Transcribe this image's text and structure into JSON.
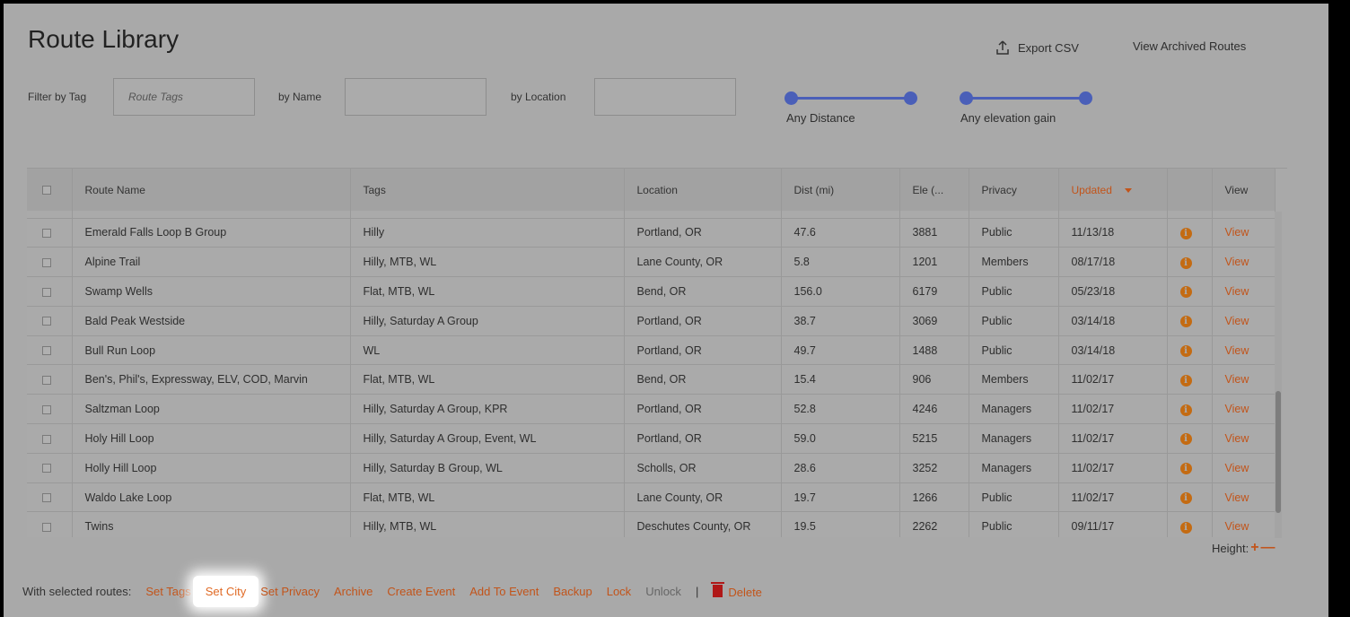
{
  "title": "Route Library",
  "actions": {
    "export": "Export CSV",
    "archived": "View Archived Routes"
  },
  "filters": {
    "tag_label": "Filter by Tag",
    "tag_placeholder": "Route Tags",
    "name_label": "by Name",
    "location_label": "by Location",
    "distance_label": "Any Distance",
    "elevation_label": "Any elevation gain"
  },
  "columns": [
    "Route Name",
    "Tags",
    "Location",
    "Dist (mi)",
    "Ele (...",
    "Privacy",
    "Updated",
    "",
    "View"
  ],
  "rows": [
    {
      "name": "Emerald Falls Loop B Group",
      "tags": "Hilly",
      "location": "Portland, OR",
      "dist": "47.6",
      "ele": "3881",
      "privacy": "Public",
      "updated": "11/13/18",
      "view": "View"
    },
    {
      "name": "Alpine Trail",
      "tags": "Hilly, MTB, WL",
      "location": "Lane County, OR",
      "dist": "5.8",
      "ele": "1201",
      "privacy": "Members",
      "updated": "08/17/18",
      "view": "View"
    },
    {
      "name": "Swamp Wells",
      "tags": "Flat, MTB, WL",
      "location": "Bend, OR",
      "dist": "156.0",
      "ele": "6179",
      "privacy": "Public",
      "updated": "05/23/18",
      "view": "View"
    },
    {
      "name": "Bald Peak Westside",
      "tags": "Hilly, Saturday A Group",
      "location": "Portland, OR",
      "dist": "38.7",
      "ele": "3069",
      "privacy": "Public",
      "updated": "03/14/18",
      "view": "View"
    },
    {
      "name": "Bull Run Loop",
      "tags": "WL",
      "location": "Portland, OR",
      "dist": "49.7",
      "ele": "1488",
      "privacy": "Public",
      "updated": "03/14/18",
      "view": "View"
    },
    {
      "name": "Ben's, Phil's, Expressway, ELV, COD, Marvin",
      "tags": "Flat, MTB, WL",
      "location": "Bend, OR",
      "dist": "15.4",
      "ele": "906",
      "privacy": "Members",
      "updated": "11/02/17",
      "view": "View"
    },
    {
      "name": "Saltzman Loop",
      "tags": "Hilly, Saturday A Group, KPR",
      "location": "Portland, OR",
      "dist": "52.8",
      "ele": "4246",
      "privacy": "Managers",
      "updated": "11/02/17",
      "view": "View"
    },
    {
      "name": "Holy Hill Loop",
      "tags": "Hilly, Saturday A Group, Event, WL",
      "location": "Portland, OR",
      "dist": "59.0",
      "ele": "5215",
      "privacy": "Managers",
      "updated": "11/02/17",
      "view": "View"
    },
    {
      "name": "Holly Hill Loop",
      "tags": "Hilly, Saturday B Group, WL",
      "location": "Scholls, OR",
      "dist": "28.6",
      "ele": "3252",
      "privacy": "Managers",
      "updated": "11/02/17",
      "view": "View"
    },
    {
      "name": "Waldo Lake Loop",
      "tags": "Flat, MTB, WL",
      "location": "Lane County, OR",
      "dist": "19.7",
      "ele": "1266",
      "privacy": "Public",
      "updated": "11/02/17",
      "view": "View"
    },
    {
      "name": "Twins",
      "tags": "Hilly, MTB, WL",
      "location": "Deschutes County, OR",
      "dist": "19.5",
      "ele": "2262",
      "privacy": "Public",
      "updated": "09/11/17",
      "view": "View"
    }
  ],
  "height_label": "Height:",
  "bulk": {
    "label": "With selected routes:",
    "set_tags": "Set Tags",
    "set_city": "Set City",
    "set_privacy": "Set Privacy",
    "archive": "Archive",
    "create_event": "Create Event",
    "add_to_event": "Add To Event",
    "backup": "Backup",
    "lock": "Lock",
    "unlock": "Unlock",
    "separator": "|",
    "delete": "Delete"
  },
  "colors": {
    "accent": "#c2541a",
    "slider": "#4a5fb8",
    "info": "#c46b12",
    "delete_icon": "#b01818"
  }
}
